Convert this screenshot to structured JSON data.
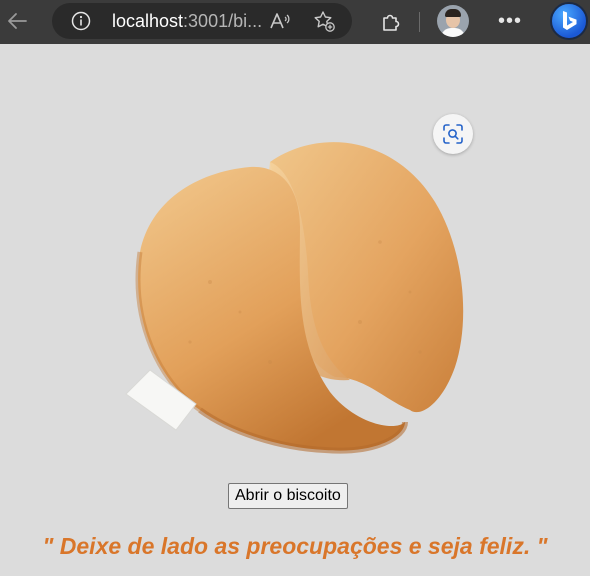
{
  "browser": {
    "url_host": "localhost",
    "url_rest": ":3001/bi...",
    "icons": {
      "back": "back-arrow-icon",
      "info": "info-icon",
      "read_aloud": "read-aloud-icon",
      "favorite": "add-favorite-icon",
      "extensions": "extensions-icon",
      "profile": "profile-avatar",
      "menu": "more-icon",
      "copilot": "bing-icon"
    },
    "menu_label": "•••"
  },
  "page": {
    "image": "fortune-cookie",
    "visual_search_icon": "visual-search-icon",
    "open_button": "Abrir o biscoito",
    "fortune": "\" Deixe de lado as preocupações e seja feliz. \"",
    "fortune_color": "#d9762a"
  }
}
